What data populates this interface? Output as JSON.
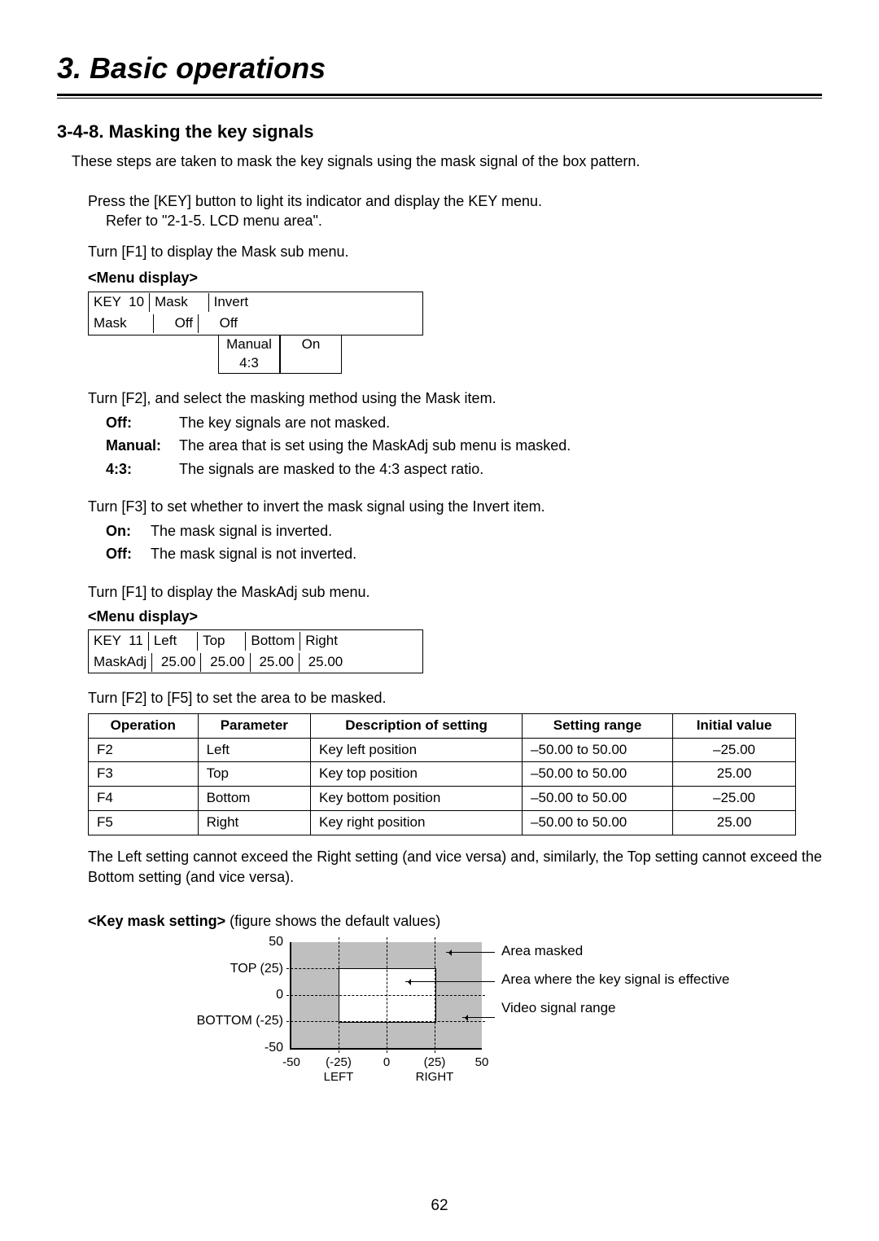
{
  "chapter": {
    "title": "3. Basic operations"
  },
  "section": {
    "title": "3-4-8. Masking the key signals",
    "intro": "These steps are taken to mask the key signals using the mask signal of the box pattern."
  },
  "steps": {
    "s1": {
      "line1": "Press the [KEY] button to light its indicator and display the KEY menu.",
      "line2": "Refer to \"2-1-5. LCD menu area\"."
    },
    "s2": {
      "line": "Turn [F1] to display the Mask sub menu."
    },
    "s3": {
      "line": "Turn [F2], and select the masking method using the Mask item.",
      "defs": {
        "off": {
          "term": "Off:",
          "desc": "The key signals are not masked."
        },
        "manual": {
          "term": "Manual:",
          "desc": "The area that is set using the MaskAdj sub menu is masked."
        },
        "r43": {
          "term": "4:3:",
          "desc": "The signals are masked to the 4:3 aspect ratio."
        }
      }
    },
    "s4": {
      "line": "Turn [F3] to set whether to invert the mask signal using the Invert item.",
      "defs": {
        "on": {
          "term": "On:",
          "desc": "The mask signal is inverted."
        },
        "off": {
          "term": "Off:",
          "desc": "The mask signal is not inverted."
        }
      }
    },
    "s5": {
      "line": "Turn [F1] to display the MaskAdj sub menu."
    },
    "s6": {
      "line": "Turn [F2] to [F5] to set the area to be masked.",
      "note": "The Left setting cannot exceed the Right setting (and vice versa) and, similarly, the Top setting cannot exceed the Bottom setting (and vice versa)."
    }
  },
  "menu1": {
    "label": "<Menu display>",
    "row1": {
      "c1": "KEY  10",
      "c2": "Mask    ",
      "c3": "Invert "
    },
    "row2": {
      "c1": "Mask",
      "c2": "Off",
      "c3": "Off"
    },
    "options": {
      "manual": "Manual",
      "ratio": "4:3",
      "on": "On"
    }
  },
  "menu2": {
    "label": "<Menu display>",
    "row1": {
      "c1": "KEY  11",
      "c2": "Left    ",
      "c3": "Top    ",
      "c4": "Bottom",
      "c5": "Right"
    },
    "row2": {
      "c1": "MaskAdj",
      "c2": " 25.00",
      "c3": " 25.00",
      "c4": " 25.00",
      "c5": " 25.00"
    }
  },
  "table": {
    "headers": [
      "Operation",
      "Parameter",
      "Description of setting",
      "Setting range",
      "Initial value"
    ],
    "rows": [
      {
        "op": "F2",
        "param": "Left",
        "desc": "Key left position",
        "range": "–50.00 to 50.00",
        "init": "–25.00"
      },
      {
        "op": "F3",
        "param": "Top",
        "desc": "Key top position",
        "range": "–50.00 to 50.00",
        "init": "25.00"
      },
      {
        "op": "F4",
        "param": "Bottom",
        "desc": "Key bottom position",
        "range": "–50.00 to 50.00",
        "init": "–25.00"
      },
      {
        "op": "F5",
        "param": "Right",
        "desc": "Key right position",
        "range": "–50.00 to 50.00",
        "init": "25.00"
      }
    ]
  },
  "figure": {
    "caption_bold": "<Key mask setting>",
    "caption_rest": " (figure shows the default values)",
    "ylabels": [
      "50",
      "TOP (25)",
      "0",
      "BOTTOM (-25)",
      "-50"
    ],
    "xlabels": [
      "-50",
      "(-25)",
      "0",
      "(25)",
      "50"
    ],
    "xsub": [
      "LEFT",
      "RIGHT"
    ],
    "legend": [
      "Area masked",
      "Area where the key signal is effective",
      "Video signal range"
    ]
  },
  "page_number": "62"
}
